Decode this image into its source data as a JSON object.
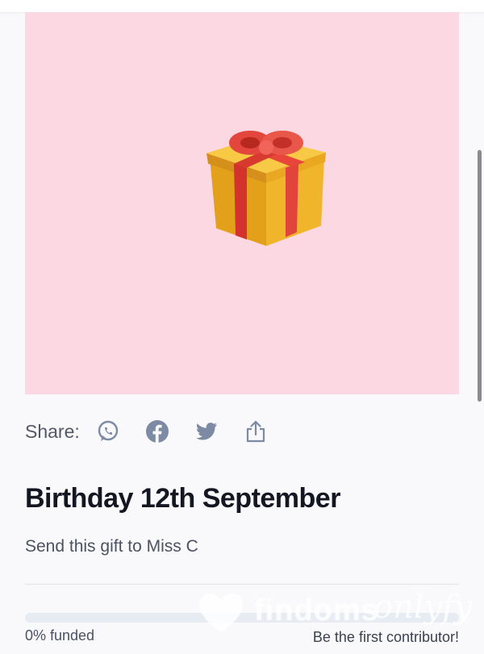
{
  "share": {
    "label": "Share:",
    "icons": [
      "whatsapp-icon",
      "facebook-icon",
      "twitter-icon",
      "share-upload-icon"
    ]
  },
  "gift": {
    "title": "Birthday 12th September",
    "subtitle": "Send this gift to Miss C",
    "image_icon": "wrapped-gift-icon",
    "hero_color": "#fcd8e2"
  },
  "progress": {
    "funded_fraction": 0,
    "funded_label": "0% funded",
    "cta": "Be the first contributor!"
  },
  "watermark": {
    "brand": "findoms",
    "script": "onlyfy"
  },
  "colors": {
    "icon": "#7d8aa3",
    "accent": "#e0457b"
  }
}
